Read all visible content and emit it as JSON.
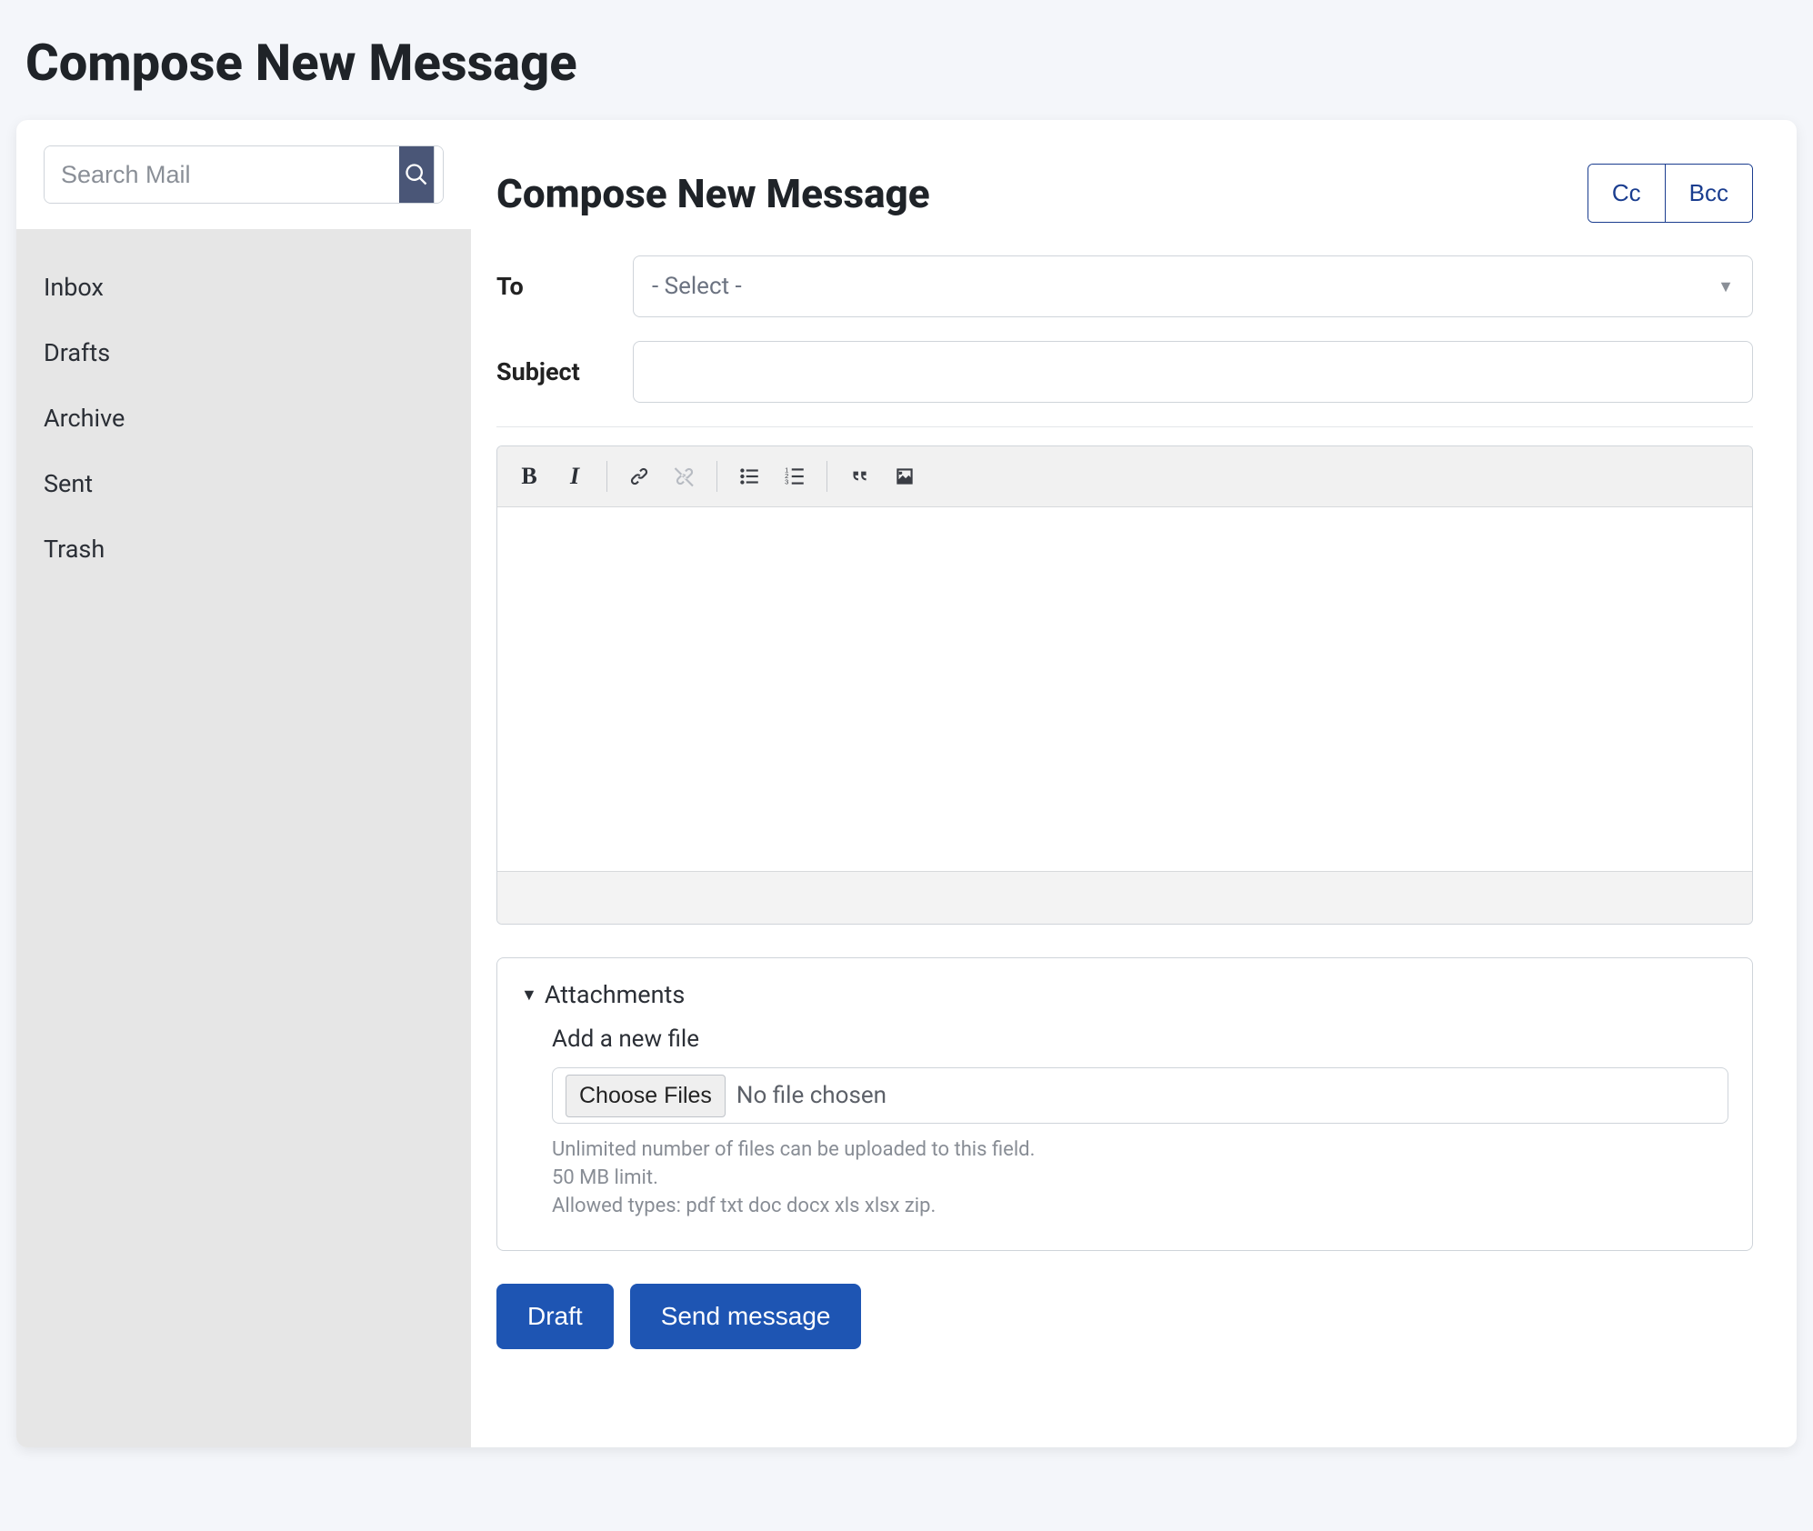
{
  "page_title": "Compose New Message",
  "sidebar": {
    "search_placeholder": "Search Mail",
    "items": [
      {
        "label": "Inbox"
      },
      {
        "label": "Drafts"
      },
      {
        "label": "Archive"
      },
      {
        "label": "Sent"
      },
      {
        "label": "Trash"
      }
    ]
  },
  "compose": {
    "header": "Compose New Message",
    "cc_label": "Cc",
    "bcc_label": "Bcc",
    "to_label": "To",
    "to_selected": "- Select -",
    "subject_label": "Subject",
    "subject_value": ""
  },
  "toolbar": {
    "bold": "bold",
    "italic": "italic",
    "link": "link",
    "unlink": "unlink",
    "bulleted_list": "bulleted-list",
    "numbered_list": "numbered-list",
    "blockquote": "blockquote",
    "image": "image"
  },
  "attachments": {
    "title": "Attachments",
    "add_label": "Add a new file",
    "choose_label": "Choose Files",
    "status": "No file chosen",
    "hint_unlimited": "Unlimited number of files can be uploaded to this field.",
    "hint_limit": "50 MB limit.",
    "hint_types": "Allowed types: pdf txt doc docx xls xlsx zip."
  },
  "actions": {
    "draft": "Draft",
    "send": "Send message"
  }
}
